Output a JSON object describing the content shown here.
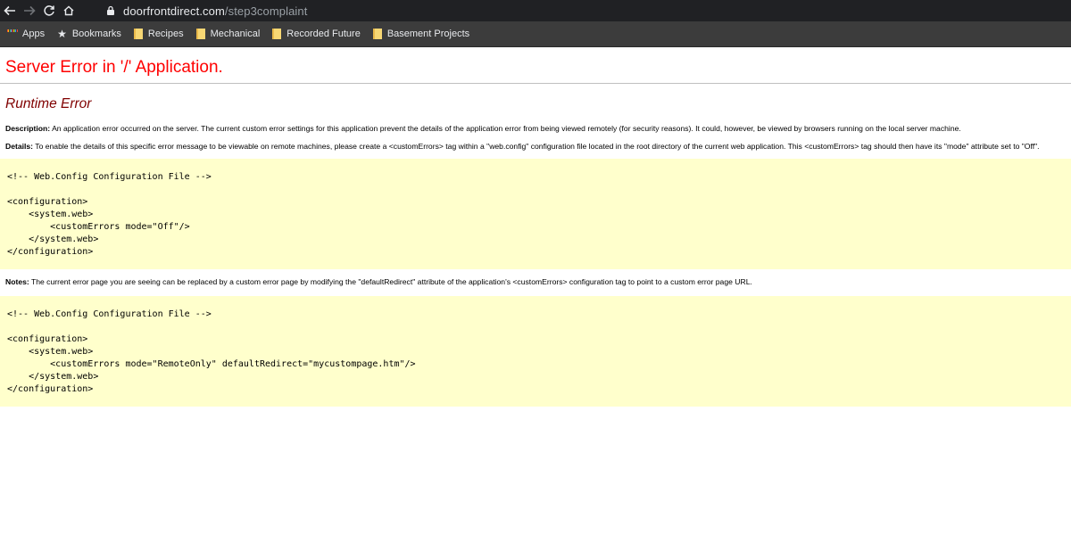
{
  "browser": {
    "url_host": "doorfrontdirect.com",
    "url_path": "/step3complaint",
    "bookmarks": [
      {
        "label": "Apps",
        "icon": "apps-grid-icon"
      },
      {
        "label": "Bookmarks",
        "icon": "star-icon"
      },
      {
        "label": "Recipes",
        "icon": "folder-icon"
      },
      {
        "label": "Mechanical",
        "icon": "folder-icon"
      },
      {
        "label": "Recorded Future",
        "icon": "folder-icon"
      },
      {
        "label": "Basement Projects",
        "icon": "folder-icon"
      }
    ]
  },
  "page": {
    "title": "Server Error in '/' Application.",
    "subtitle": "Runtime Error",
    "description_label": "Description:",
    "description_text": "An application error occurred on the server. The current custom error settings for this application prevent the details of the application error from being viewed remotely (for security reasons). It could, however, be viewed by browsers running on the local server machine.",
    "details_label": "Details:",
    "details_text": "To enable the details of this specific error message to be viewable on remote machines, please create a <customErrors> tag within a \"web.config\" configuration file located in the root directory of the current web application. This <customErrors> tag should then have its \"mode\" attribute set to \"Off\".",
    "notes_label": "Notes:",
    "notes_text": "The current error page you are seeing can be replaced by a custom error page by modifying the \"defaultRedirect\" attribute of the application's <customErrors> configuration tag to point to a custom error page URL.",
    "code1": [
      "<!-- Web.Config Configuration File -->",
      "",
      "<configuration>",
      "    <system.web>",
      "        <customErrors mode=\"Off\"/>",
      "    </system.web>",
      "</configuration>"
    ],
    "code2": [
      "<!-- Web.Config Configuration File -->",
      "",
      "<configuration>",
      "    <system.web>",
      "        <customErrors mode=\"RemoteOnly\" defaultRedirect=\"mycustompage.htm\"/>",
      "    </system.web>",
      "</configuration>"
    ]
  },
  "colors": {
    "title": "#ff0000",
    "subtitle": "#800000",
    "code_bg": "#ffffcc",
    "chrome_dark": "#202124",
    "bookmarks_bar": "#3c3c3c"
  }
}
